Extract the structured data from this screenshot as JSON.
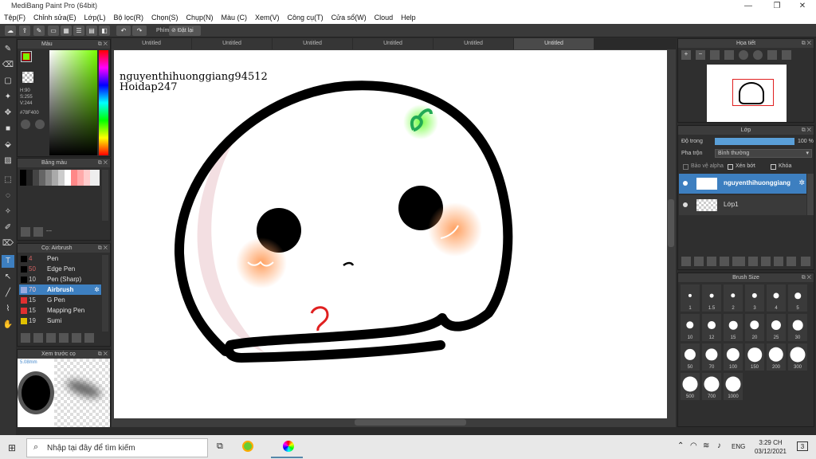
{
  "window": {
    "title": "MediBang Paint Pro (64bit)"
  },
  "menu": [
    "Tệp(F)",
    "Chỉnh sửa(E)",
    "Lớp(L)",
    "Bộ lọc(R)",
    "Chọn(S)",
    "Chụp(N)",
    "Màu (C)",
    "Xem(V)",
    "Công cụ(T)",
    "Cửa sổ(W)",
    "Cloud",
    "Help"
  ],
  "toolbar": {
    "key_label": "Phím",
    "reset_label": "Đặt lại"
  },
  "color_panel": {
    "title": "Màu",
    "h": "H:90",
    "s": "S:255",
    "v": "V:244",
    "hex": "#78F400",
    "fg": "#78F400",
    "bg": "#000000"
  },
  "palette_panel": {
    "title": "Bảng màu",
    "value": "---"
  },
  "brush_panel": {
    "title": "Cọ: Airbrush",
    "items": [
      {
        "num": "4",
        "label": "Pen",
        "color": "#000000"
      },
      {
        "num": "50",
        "label": "Edge Pen",
        "color": "#000000"
      },
      {
        "num": "10",
        "label": "Pen (Sharp)",
        "color": "#000000"
      },
      {
        "num": "70",
        "label": "Airbrush",
        "color": "#87c0f0"
      },
      {
        "num": "15",
        "label": "G Pen",
        "color": "#e03030"
      },
      {
        "num": "15",
        "label": "Mapping Pen",
        "color": "#e03030"
      },
      {
        "num": "19",
        "label": "Sumi",
        "color": "#e0c000"
      }
    ]
  },
  "preview_panel": {
    "title": "Xem trước cọ",
    "size": "5.08mm"
  },
  "tabs": [
    "Untitled",
    "Untitled",
    "Untitled",
    "Untitled",
    "Untitled",
    "Untitled"
  ],
  "canvas": {
    "line1": "nguyenthihuonggiang94512",
    "line2": "Hoidap247"
  },
  "navigator": {
    "title": "Họa tiết"
  },
  "layer_panel": {
    "title": "Lớp",
    "opacity_label": "Độ trong",
    "opacity_value": "100 %",
    "blend_label": "Pha trộn",
    "blend_value": "Bình thường",
    "protect_alpha": "Bảo vệ alpha",
    "clipping": "Xén bớt",
    "lock": "Khóa",
    "layers": [
      {
        "name": "nguyenthihuonggiang"
      },
      {
        "name": "Lớp1"
      }
    ]
  },
  "brush_size_panel": {
    "title": "Brush Size",
    "sizes": [
      "1",
      "1.5",
      "2",
      "3",
      "4",
      "5",
      "10",
      "12",
      "15",
      "20",
      "25",
      "30",
      "50",
      "70",
      "100",
      "150",
      "200",
      "300",
      "500",
      "700",
      "1000"
    ]
  },
  "taskbar": {
    "search_placeholder": "Nhập tại đây để tìm kiếm",
    "lang": "ENG",
    "time": "3:29 CH",
    "date": "03/12/2021",
    "notif": "3"
  }
}
